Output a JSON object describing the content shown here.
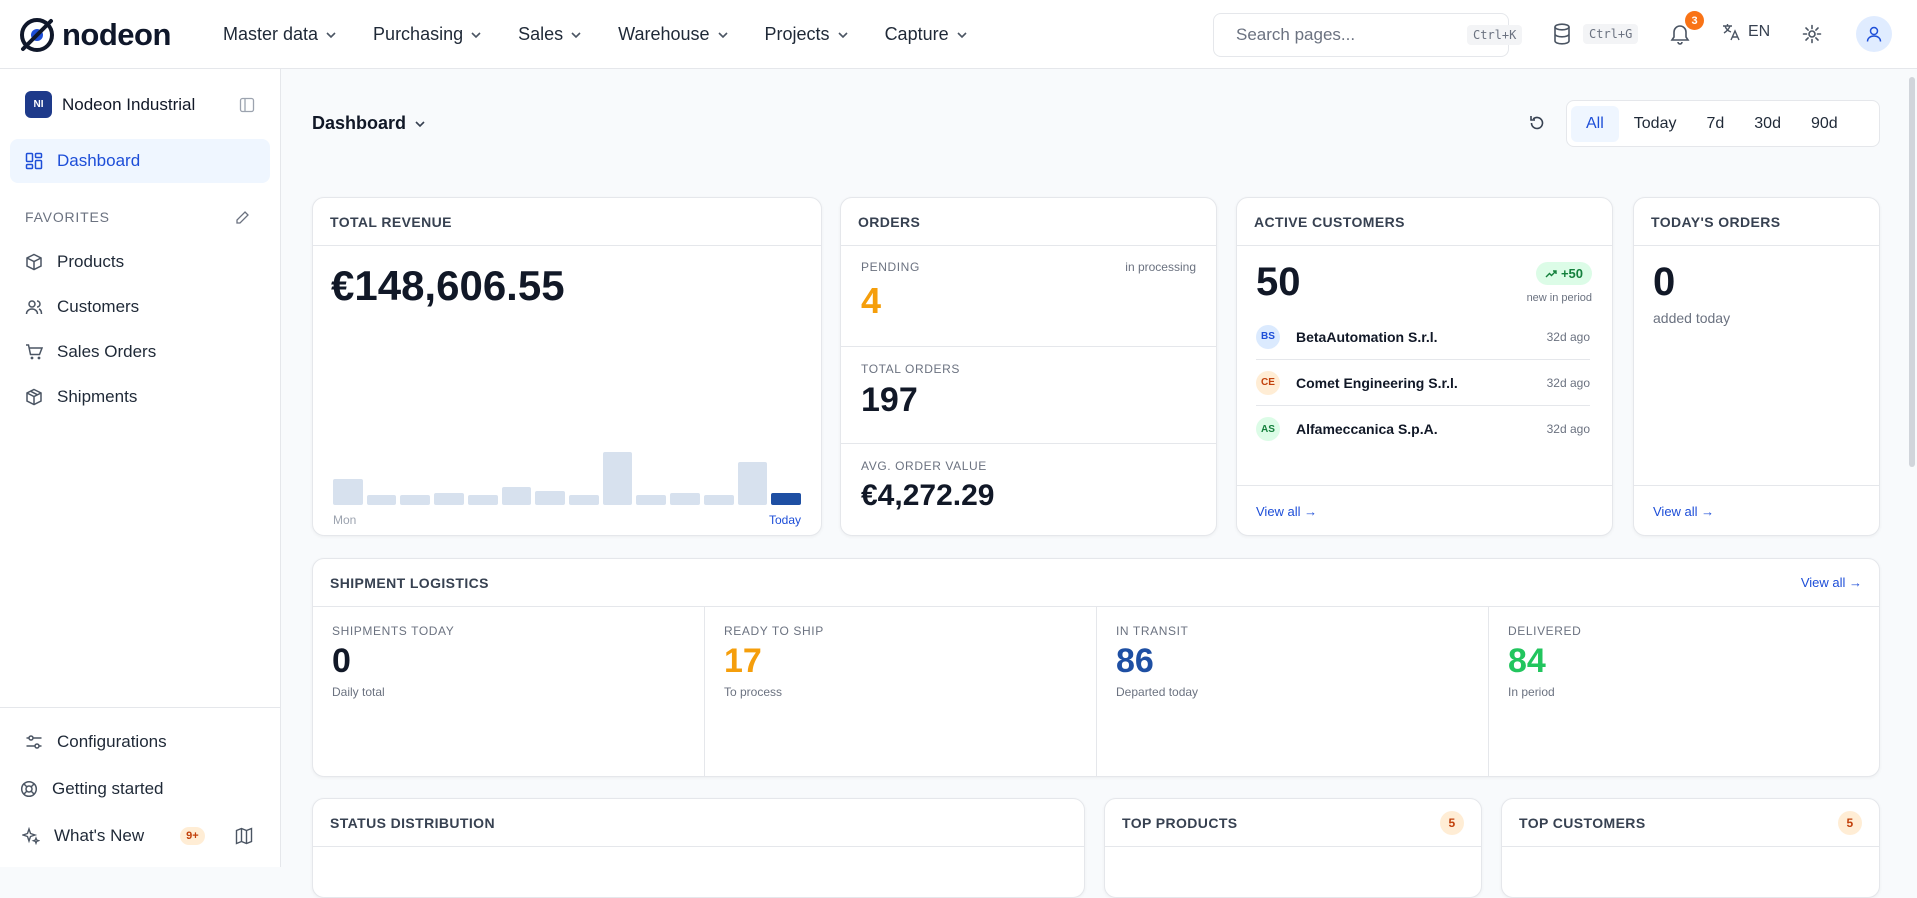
{
  "app": {
    "logo_text": "nodeon"
  },
  "nav": [
    "Master data",
    "Purchasing",
    "Sales",
    "Warehouse",
    "Projects",
    "Capture"
  ],
  "search": {
    "placeholder": "Search pages...",
    "shortcut": "Ctrl+K"
  },
  "topbar": {
    "db_shortcut": "Ctrl+G",
    "notifications": "3",
    "language": "EN"
  },
  "sidebar": {
    "workspace": {
      "initials": "NI",
      "name": "Nodeon Industrial"
    },
    "dashboard": "Dashboard",
    "favorites_label": "FAVORITES",
    "favorites": [
      "Products",
      "Customers",
      "Sales Orders",
      "Shipments"
    ],
    "bottom": {
      "configurations": "Configurations",
      "getting_started": "Getting started",
      "whats_new": "What's New",
      "whats_new_badge": "9+"
    }
  },
  "header": {
    "title": "Dashboard",
    "ranges": [
      "All",
      "Today",
      "7d",
      "30d",
      "90d"
    ],
    "selected_range": "All"
  },
  "revenue": {
    "label": "TOTAL REVENUE",
    "value": "€148,606.55",
    "bars": [
      0.48,
      0.19,
      0.19,
      0.22,
      0.19,
      0.33,
      0.26,
      0.19,
      0.96,
      0.19,
      0.22,
      0.19,
      0.78,
      0.22
    ],
    "x_start": "Mon",
    "x_end": "Today"
  },
  "orders": {
    "label": "ORDERS",
    "pending_label": "PENDING",
    "pending_note": "in processing",
    "pending": "4",
    "total_label": "TOTAL ORDERS",
    "total": "197",
    "aov_label": "AVG. ORDER VALUE",
    "aov": "€4,272.29"
  },
  "customers": {
    "label": "ACTIVE CUSTOMERS",
    "value": "50",
    "delta": "+50",
    "delta_note": "new in period",
    "list": [
      {
        "initials": "BS",
        "name": "BetaAutomation S.r.l.",
        "ago": "32d ago"
      },
      {
        "initials": "CE",
        "name": "Comet Engineering S.r.l.",
        "ago": "32d ago"
      },
      {
        "initials": "AS",
        "name": "Alfameccanica S.p.A.",
        "ago": "32d ago"
      }
    ],
    "view_all": "View all →"
  },
  "today_orders": {
    "label": "TODAY'S ORDERS",
    "value": "0",
    "note": "added today",
    "view_all": "View all →"
  },
  "shipments": {
    "label": "SHIPMENT LOGISTICS",
    "view_all": "View all →",
    "stats": [
      {
        "label": "SHIPMENTS TODAY",
        "value": "0",
        "note": "Daily total",
        "color": "#111827"
      },
      {
        "label": "READY TO SHIP",
        "value": "17",
        "note": "To process",
        "color": "#f59e0b"
      },
      {
        "label": "IN TRANSIT",
        "value": "86",
        "note": "Departed today",
        "color": "#1e4fa3"
      },
      {
        "label": "DELIVERED",
        "value": "84",
        "note": "In period",
        "color": "#22c55e"
      }
    ]
  },
  "bottom_cards": {
    "status": "STATUS DISTRIBUTION",
    "top_products": "TOP PRODUCTS",
    "top_products_count": "5",
    "top_customers": "TOP CUSTOMERS",
    "top_customers_count": "5"
  },
  "colors": {
    "accent": "#1d4ed8",
    "brand": "#1e3a8a",
    "pending": "#f59e0b"
  }
}
